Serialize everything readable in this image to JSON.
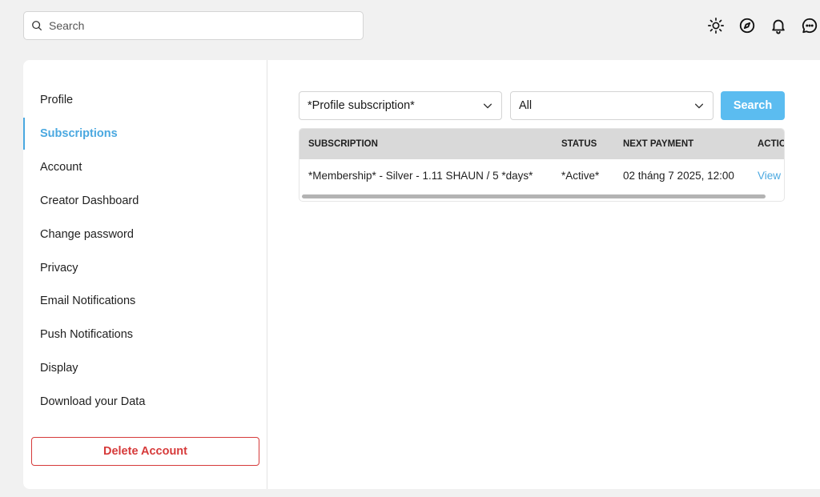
{
  "search": {
    "placeholder": "Search"
  },
  "top_icons": [
    "sun-icon",
    "compass-icon",
    "bell-icon",
    "chat-icon"
  ],
  "sidebar": {
    "items": [
      {
        "label": "Profile",
        "active": false
      },
      {
        "label": "Subscriptions",
        "active": true
      },
      {
        "label": "Account",
        "active": false
      },
      {
        "label": "Creator Dashboard",
        "active": false
      },
      {
        "label": "Change password",
        "active": false
      },
      {
        "label": "Privacy",
        "active": false
      },
      {
        "label": "Email Notifications",
        "active": false
      },
      {
        "label": "Push Notifications",
        "active": false
      },
      {
        "label": "Display",
        "active": false
      },
      {
        "label": "Download your Data",
        "active": false
      }
    ],
    "delete_label": "Delete Account"
  },
  "filters": {
    "type_value": "*Profile subscription*",
    "status_value": "All",
    "search_label": "Search"
  },
  "table": {
    "headers": {
      "subscription": "SUBSCRIPTION",
      "status": "STATUS",
      "next_payment": "NEXT PAYMENT",
      "action": "ACTIONS"
    },
    "rows": [
      {
        "subscription": "*Membership* - Silver - 1.11 SHAUN / 5 *days*",
        "status": "*Active*",
        "next_payment": "02 tháng 7 2025, 12:00",
        "action": "View"
      }
    ]
  },
  "colors": {
    "accent": "#4aa8e0",
    "button": "#5bbcf0",
    "danger": "#d63a3a",
    "background": "#f1f1f1"
  }
}
